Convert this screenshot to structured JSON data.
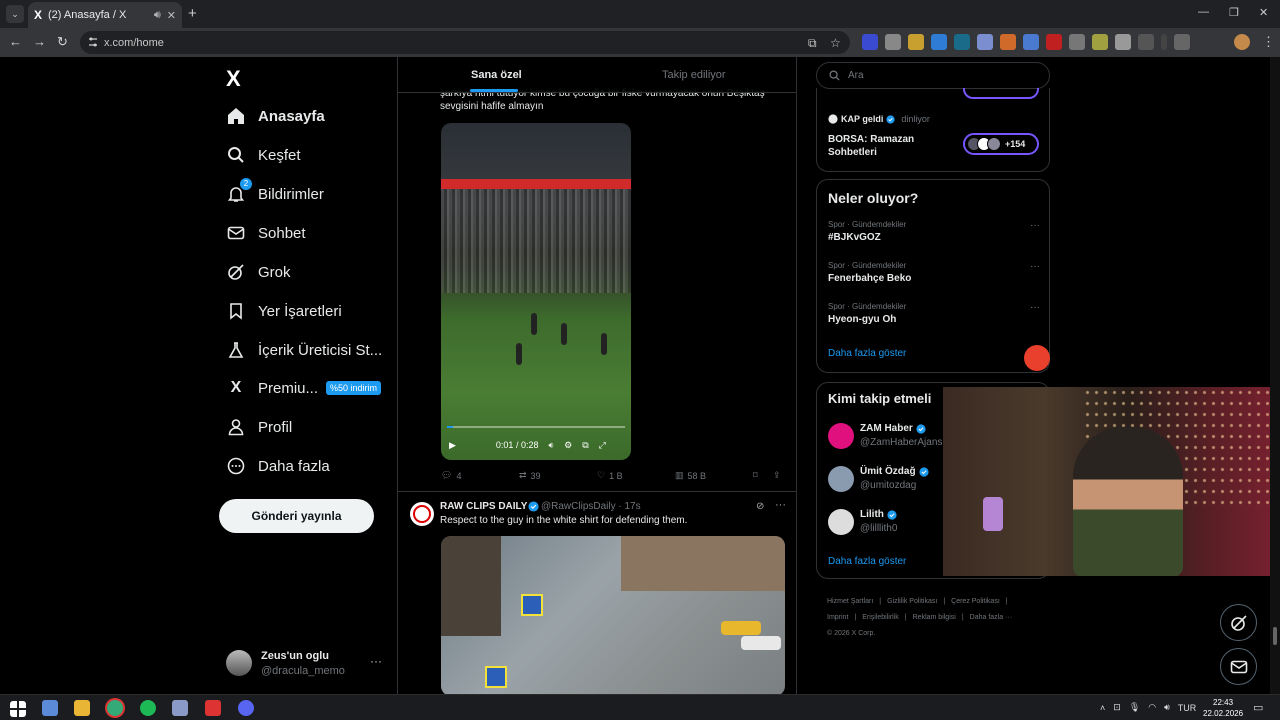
{
  "browser": {
    "tab_title": "(2) Anasayfa / X",
    "tab_favicon": "X",
    "url": "x.com/home"
  },
  "nav": {
    "logo": "X",
    "items": [
      {
        "label": "Anasayfa",
        "icon": "home-icon"
      },
      {
        "label": "Keşfet",
        "icon": "search-icon"
      },
      {
        "label": "Bildirimler",
        "icon": "bell-icon",
        "badge": "2"
      },
      {
        "label": "Sohbet",
        "icon": "mail-icon"
      },
      {
        "label": "Grok",
        "icon": "grok-icon"
      },
      {
        "label": "Yer İşaretleri",
        "icon": "bookmark-icon"
      },
      {
        "label": "İçerik Üreticisi St...",
        "icon": "flask-icon"
      },
      {
        "label": "Premiu...",
        "icon": "x-icon",
        "tag": "%50 indirim"
      },
      {
        "label": "Profil",
        "icon": "person-icon"
      },
      {
        "label": "Daha fazla",
        "icon": "more-circle-icon"
      }
    ],
    "post_button": "Gönderi yayınla",
    "account": {
      "name": "Zeus'un oglu",
      "handle": "@dracula_memo"
    }
  },
  "timeline": {
    "tabs": [
      "Sana özel",
      "Takip ediliyor"
    ],
    "tweet1": {
      "text": "şarkıya ritmi tutuyor kimse bu çocuğa bir fiske vurmayacak onun Beşiktaş sevgisini hafife almayın",
      "video_time": "0:01 / 0:28",
      "replies": "4",
      "reposts": "39",
      "likes": "1 B",
      "views": "58 B"
    },
    "tweet2": {
      "name": "RAW CLIPS DAILY",
      "handle": "@RawClipsDaily · 17s",
      "text": "Respect to the guy in the white shirt for defending them."
    }
  },
  "sidebar": {
    "search_placeholder": "Ara",
    "space": {
      "host": "KAP geldi",
      "host_sub": "dinliyor",
      "title": "BORSA: Ramazan Sohbetleri",
      "count": "+154"
    },
    "trends_title": "Neler oluyor?",
    "trends": [
      {
        "category": "Spor · Gündemdekiler",
        "name": "#BJKvGOZ"
      },
      {
        "category": "Spor · Gündemdekiler",
        "name": "Fenerbahçe Beko"
      },
      {
        "category": "Spor · Gündemdekiler",
        "name": "Hyeon-gyu Oh"
      }
    ],
    "trends_more": "Daha fazla göster",
    "wtf_title": "Kimi takip etmeli",
    "wtf": [
      {
        "name": "ZAM Haber",
        "handle": "@ZamHaberAjans",
        "color": "#e0107f"
      },
      {
        "name": "Ümit Özdağ",
        "handle": "@umitozdag",
        "color": "#8a9bb0"
      },
      {
        "name": "Lilith",
        "handle": "@lilllith0",
        "color": "#ddd"
      }
    ],
    "wtf_more": "Daha fazla göster",
    "footer": [
      "Hizmet Şartları",
      "Gizlilik Politikası",
      "Çerez Politikası",
      "Imprint",
      "Erişilebilirlik",
      "Reklam bilgisi",
      "Daha fazla ···",
      "© 2026 X Corp."
    ]
  },
  "taskbar": {
    "lang": "TUR",
    "time": "22:43",
    "date": "22.02.2026"
  },
  "colors": {
    "accent": "#1d9bf0",
    "background": "#000000",
    "border": "#2f3336",
    "muted": "#71767b"
  }
}
